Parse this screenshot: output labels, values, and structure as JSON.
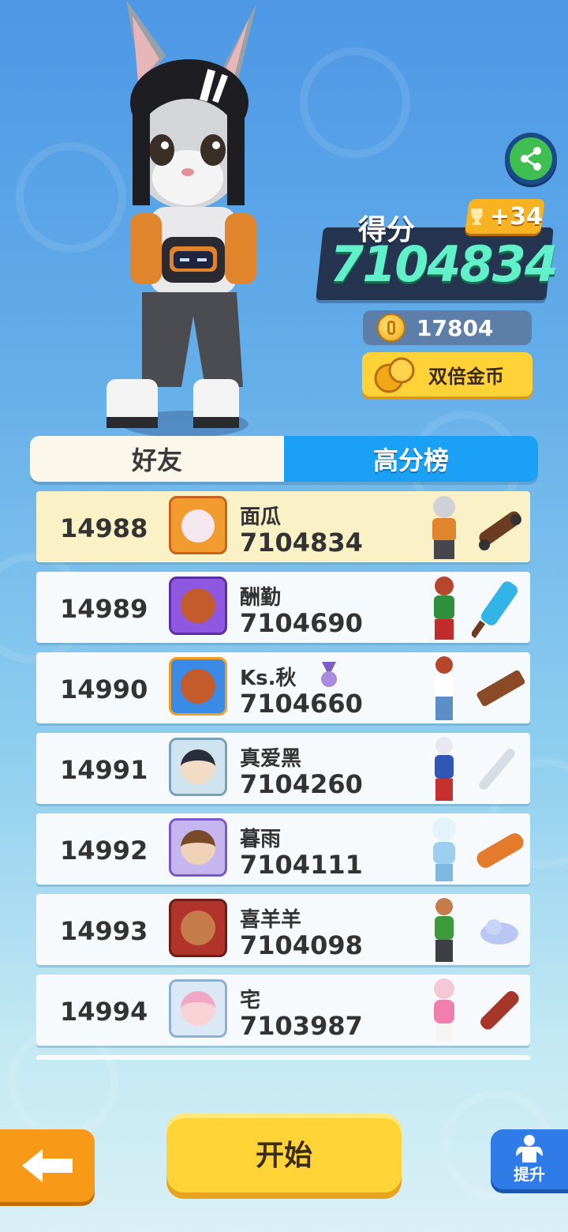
{
  "score": {
    "label": "得分",
    "value": "7104834",
    "trophy_delta": "+34"
  },
  "coins": {
    "count": "17804"
  },
  "double_coins": {
    "label": "双倍金币"
  },
  "tabs": [
    {
      "label": "好友",
      "selected": false
    },
    {
      "label": "高分榜",
      "selected": true
    }
  ],
  "leaderboard": [
    {
      "rank": "14988",
      "name": "面瓜",
      "score": "7104834",
      "is_me": true
    },
    {
      "rank": "14989",
      "name": "酬勤",
      "score": "7104690"
    },
    {
      "rank": "14990",
      "name": "Ks.秋",
      "score": "7104660",
      "badge": "medal-icon"
    },
    {
      "rank": "14991",
      "name": "真爱黑",
      "score": "7104260"
    },
    {
      "rank": "14992",
      "name": "暮雨",
      "score": "7104111"
    },
    {
      "rank": "14993",
      "name": "喜羊羊",
      "score": "7104098"
    },
    {
      "rank": "14994",
      "name": "宅",
      "score": "7103987"
    }
  ],
  "buttons": {
    "start": "开始",
    "upgrade": "提升"
  },
  "colors": {
    "accent_tab": "#1aa0f4",
    "start": "#ffd437",
    "score_text": "#61f0c9",
    "back": "#f89a17",
    "share": "#3fbf52"
  }
}
